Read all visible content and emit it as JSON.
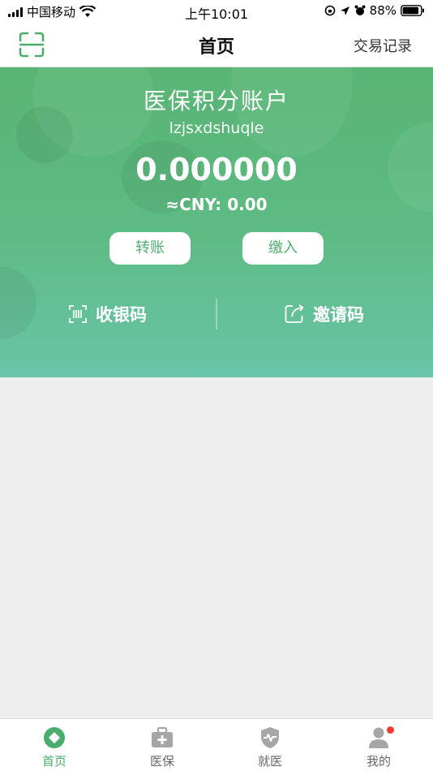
{
  "status_bar": {
    "carrier": "中国移动",
    "time": "上午10:01",
    "battery": "88%"
  },
  "nav": {
    "title": "首页",
    "history_label": "交易记录"
  },
  "account": {
    "title": "医保积分账户",
    "username": "lzjsxdshuqle",
    "balance": "0.000000",
    "cny": "≈CNY: 0.00",
    "transfer_label": "转账",
    "pay_label": "缴入",
    "cashier_label": "收银码",
    "invite_label": "邀请码"
  },
  "tabs": [
    {
      "label": "首页",
      "active": true
    },
    {
      "label": "医保",
      "active": false
    },
    {
      "label": "就医",
      "active": false
    },
    {
      "label": "我的",
      "active": false
    }
  ],
  "colors": {
    "accent": "#49ad6d",
    "hero_top": "#58b574",
    "hero_bottom": "#69c4a8",
    "badge": "#f03a2e"
  }
}
